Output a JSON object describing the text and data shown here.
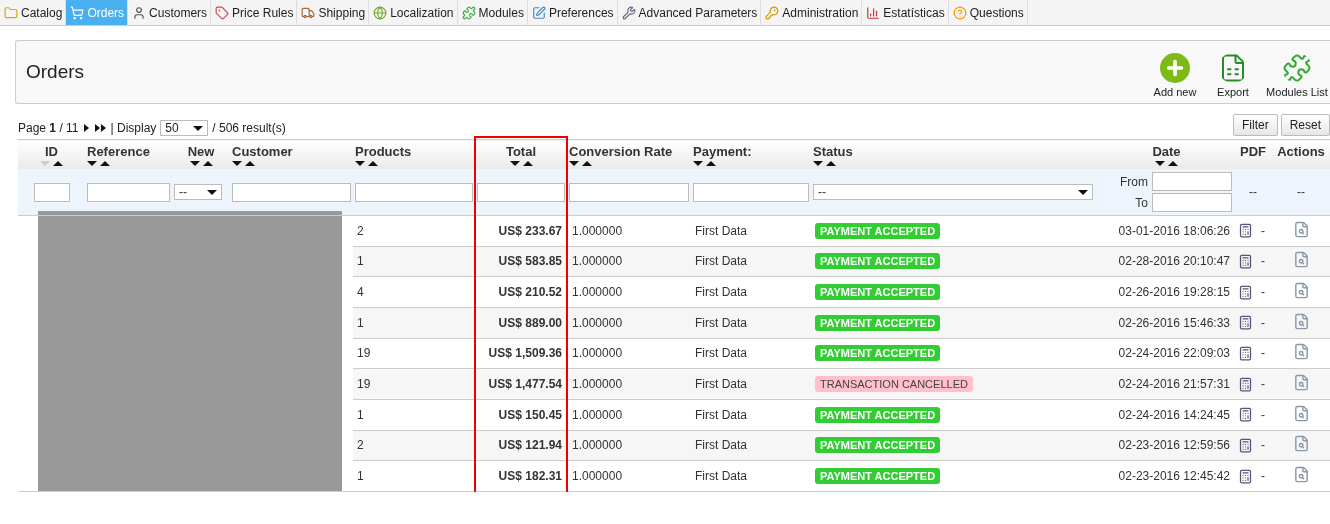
{
  "tabs": [
    {
      "label": "Catalog",
      "selected": false
    },
    {
      "label": "Orders",
      "selected": true
    },
    {
      "label": "Customers",
      "selected": false
    },
    {
      "label": "Price Rules",
      "selected": false
    },
    {
      "label": "Shipping",
      "selected": false
    },
    {
      "label": "Localization",
      "selected": false
    },
    {
      "label": "Modules",
      "selected": false
    },
    {
      "label": "Preferences",
      "selected": false
    },
    {
      "label": "Advanced Parameters",
      "selected": false
    },
    {
      "label": "Administration",
      "selected": false
    },
    {
      "label": "Estatísticas",
      "selected": false
    },
    {
      "label": "Questions",
      "selected": false
    }
  ],
  "header": {
    "title": "Orders",
    "actions": [
      "Add new",
      "Export",
      "Modules List"
    ]
  },
  "pager": {
    "page": "Page **1** / 11",
    "display_label": "| Display",
    "per_page": "50",
    "results": "/ 506 result(s)"
  },
  "filter_buttons": [
    "Filter",
    "Reset"
  ],
  "table": {
    "columns": [
      {
        "label": "ID",
        "sortable": true,
        "sorted_descending": true,
        "highlighted": false,
        "filter": {
          "kind": "text"
        }
      },
      {
        "label": "Reference",
        "sortable": true,
        "sorted_descending": false,
        "highlighted": false,
        "filter": {
          "kind": "text"
        }
      },
      {
        "label": "New",
        "sortable": true,
        "sorted_descending": false,
        "highlighted": false,
        "filter": {
          "kind": "select",
          "value": "--"
        }
      },
      {
        "label": "Customer",
        "sortable": true,
        "sorted_descending": false,
        "highlighted": false,
        "filter": {
          "kind": "text"
        }
      },
      {
        "label": "Products",
        "sortable": true,
        "sorted_descending": false,
        "highlighted": false,
        "filter": {
          "kind": "text"
        }
      },
      {
        "label": "Total",
        "sortable": true,
        "sorted_descending": false,
        "highlighted": true,
        "filter": {
          "kind": "text"
        }
      },
      {
        "label": "Conversion Rate",
        "sortable": true,
        "sorted_descending": false,
        "highlighted": false,
        "filter": {
          "kind": "text"
        }
      },
      {
        "label": "Payment:",
        "sortable": true,
        "sorted_descending": false,
        "highlighted": false,
        "filter": {
          "kind": "text"
        }
      },
      {
        "label": "Status",
        "sortable": true,
        "sorted_descending": false,
        "highlighted": false,
        "filter": {
          "kind": "select",
          "value": "--"
        }
      },
      {
        "label": "Date",
        "sortable": true,
        "sorted_descending": false,
        "highlighted": false,
        "filter": {
          "kind": "date_range",
          "from": "From",
          "to": "To"
        }
      },
      {
        "label": "PDF",
        "sortable": false,
        "highlighted": false,
        "filter": {
          "kind": "none",
          "value": "--"
        }
      },
      {
        "label": "Actions",
        "sortable": false,
        "highlighted": false,
        "filter": {
          "kind": "none",
          "value": "--"
        }
      }
    ],
    "rows": [
      {
        "products": "2",
        "total": "US$ 233.67",
        "rate": "1.000000",
        "payment": "First Data",
        "status": {
          "label": "PAYMENT ACCEPTED",
          "kind": "accepted"
        },
        "date": "03-01-2016 18:06:26",
        "pdf": "-"
      },
      {
        "products": "1",
        "total": "US$ 583.85",
        "rate": "1.000000",
        "payment": "First Data",
        "status": {
          "label": "PAYMENT ACCEPTED",
          "kind": "accepted"
        },
        "date": "02-28-2016 20:10:47",
        "pdf": "-"
      },
      {
        "products": "4",
        "total": "US$ 210.52",
        "rate": "1.000000",
        "payment": "First Data",
        "status": {
          "label": "PAYMENT ACCEPTED",
          "kind": "accepted"
        },
        "date": "02-26-2016 19:28:15",
        "pdf": "-"
      },
      {
        "products": "1",
        "total": "US$ 889.00",
        "rate": "1.000000",
        "payment": "First Data",
        "status": {
          "label": "PAYMENT ACCEPTED",
          "kind": "accepted"
        },
        "date": "02-26-2016 15:46:33",
        "pdf": "-"
      },
      {
        "products": "19",
        "total": "US$ 1,509.36",
        "rate": "1.000000",
        "payment": "First Data",
        "status": {
          "label": "PAYMENT ACCEPTED",
          "kind": "accepted"
        },
        "date": "02-24-2016 22:09:03",
        "pdf": "-"
      },
      {
        "products": "19",
        "total": "US$ 1,477.54",
        "rate": "1.000000",
        "payment": "First Data",
        "status": {
          "label": "TRANSACTION CANCELLED",
          "kind": "cancelled"
        },
        "date": "02-24-2016 21:57:31",
        "pdf": "-"
      },
      {
        "products": "1",
        "total": "US$ 150.45",
        "rate": "1.000000",
        "payment": "First Data",
        "status": {
          "label": "PAYMENT ACCEPTED",
          "kind": "accepted"
        },
        "date": "02-24-2016 14:24:45",
        "pdf": "-"
      },
      {
        "products": "2",
        "total": "US$ 121.94",
        "rate": "1.000000",
        "payment": "First Data",
        "status": {
          "label": "PAYMENT ACCEPTED",
          "kind": "accepted"
        },
        "date": "02-23-2016 12:59:56",
        "pdf": "-"
      },
      {
        "products": "1",
        "total": "US$ 182.31",
        "rate": "1.000000",
        "payment": "First Data",
        "status": {
          "label": "PAYMENT ACCEPTED",
          "kind": "accepted"
        },
        "date": "02-23-2016 12:45:42",
        "pdf": "-"
      }
    ]
  }
}
